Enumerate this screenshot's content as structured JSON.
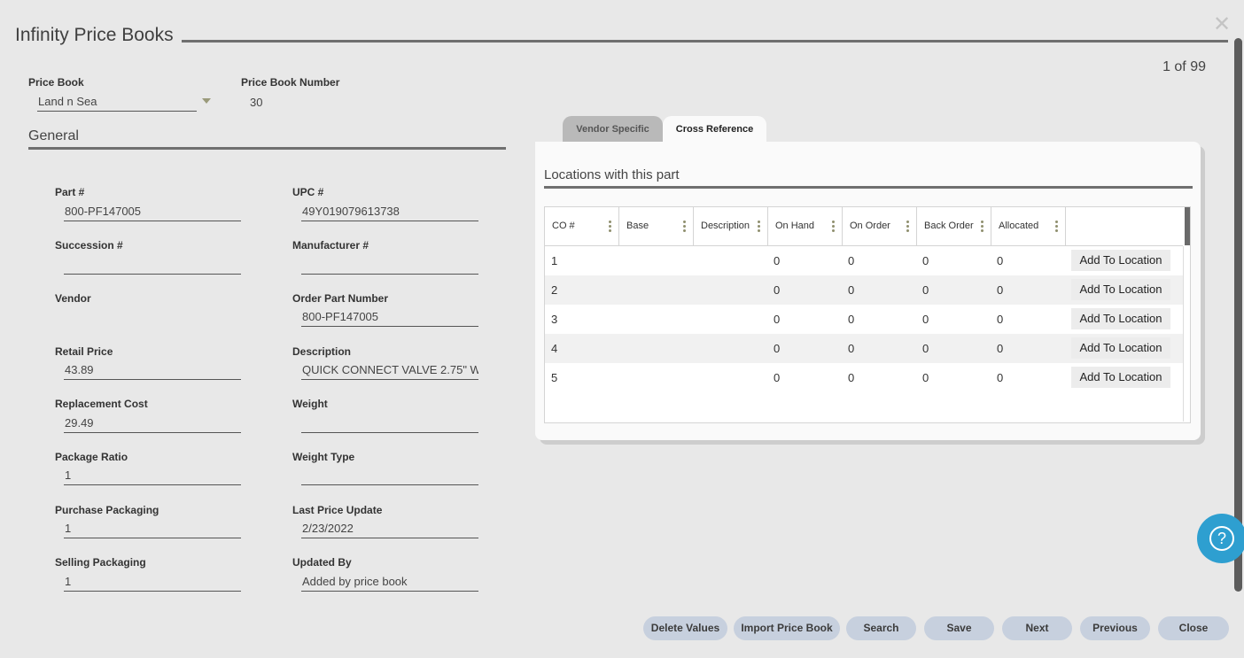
{
  "window": {
    "title": "Infinity Price Books",
    "record_position": "1 of 99"
  },
  "header": {
    "price_book_label": "Price Book",
    "price_book_value": "Land n Sea",
    "price_book_number_label": "Price Book Number",
    "price_book_number_value": "30"
  },
  "general": {
    "heading": "General",
    "part_label": "Part #",
    "part_value": "800-PF147005",
    "upc_label": "UPC #",
    "upc_value": "49Y019079613738",
    "succession_label": "Succession #",
    "succession_value": "",
    "manufacturer_label": "Manufacturer #",
    "manufacturer_value": "",
    "vendor_label": "Vendor",
    "vendor_value": "",
    "order_part_label": "Order Part Number",
    "order_part_value": "800-PF147005",
    "retail_price_label": "Retail Price",
    "retail_price_value": "43.89",
    "description_label": "Description",
    "description_value": "QUICK CONNECT VALVE 2.75\" W",
    "replacement_cost_label": "Replacement Cost",
    "replacement_cost_value": "29.49",
    "weight_label": "Weight",
    "weight_value": "",
    "package_ratio_label": "Package Ratio",
    "package_ratio_value": "1",
    "weight_type_label": "Weight Type",
    "weight_type_value": "",
    "purchase_packaging_label": "Purchase Packaging",
    "purchase_packaging_value": "1",
    "last_price_update_label": "Last Price Update",
    "last_price_update_value": "2/23/2022",
    "selling_packaging_label": "Selling Packaging",
    "selling_packaging_value": "1",
    "updated_by_label": "Updated By",
    "updated_by_value": "Added by price book"
  },
  "tabs": {
    "vendor_specific": "Vendor Specific",
    "cross_reference": "Cross Reference"
  },
  "locations": {
    "heading": "Locations with this part",
    "columns": [
      "CO #",
      "Base",
      "Description",
      "On Hand",
      "On Order",
      "Back Order",
      "Allocated"
    ],
    "rows": [
      {
        "co": "1",
        "base": "",
        "description": "",
        "on_hand": "0",
        "on_order": "0",
        "back_order": "0",
        "allocated": "0",
        "action": "Add To Location"
      },
      {
        "co": "2",
        "base": "",
        "description": "",
        "on_hand": "0",
        "on_order": "0",
        "back_order": "0",
        "allocated": "0",
        "action": "Add To Location"
      },
      {
        "co": "3",
        "base": "",
        "description": "",
        "on_hand": "0",
        "on_order": "0",
        "back_order": "0",
        "allocated": "0",
        "action": "Add To Location"
      },
      {
        "co": "4",
        "base": "",
        "description": "",
        "on_hand": "0",
        "on_order": "0",
        "back_order": "0",
        "allocated": "0",
        "action": "Add To Location"
      },
      {
        "co": "5",
        "base": "",
        "description": "",
        "on_hand": "0",
        "on_order": "0",
        "back_order": "0",
        "allocated": "0",
        "action": "Add To Location"
      }
    ]
  },
  "actions": {
    "delete_values": "Delete Values",
    "import_price_book": "Import Price Book",
    "search": "Search",
    "save": "Save",
    "next": "Next",
    "previous": "Previous",
    "close": "Close"
  },
  "icons": {
    "close": "close-icon",
    "dropdown": "chevron-down-icon",
    "help": "help-chat-icon",
    "column_menu": "kebab-icon"
  },
  "colors": {
    "help_button": "#2e9fd0",
    "action_button": "#c7d0de"
  }
}
